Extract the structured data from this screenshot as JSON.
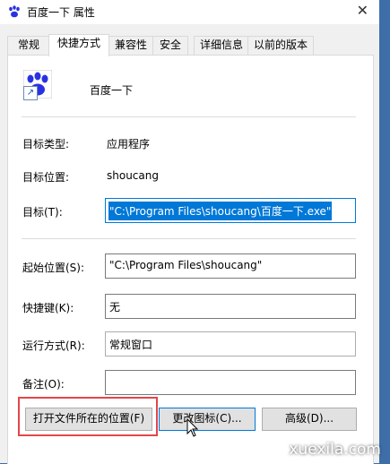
{
  "window": {
    "title": "百度一下 属性"
  },
  "tabs": [
    {
      "label": "常规"
    },
    {
      "label": "快捷方式"
    },
    {
      "label": "兼容性"
    },
    {
      "label": "安全"
    },
    {
      "label": "详细信息"
    },
    {
      "label": "以前的版本"
    }
  ],
  "active_tab": "快捷方式",
  "shortcut": {
    "name": "百度一下",
    "target_type_label": "目标类型:",
    "target_type_value": "应用程序",
    "target_location_label": "目标位置:",
    "target_location_value": "shoucang",
    "target_label": "目标(T):",
    "target_value": "\"C:\\Program Files\\shoucang\\百度一下.exe\"",
    "start_in_label": "起始位置(S):",
    "start_in_value": "\"C:\\Program Files\\shoucang\"",
    "hotkey_label": "快捷键(K):",
    "hotkey_value": "无",
    "run_label": "运行方式(R):",
    "run_value": "常规窗口",
    "comment_label": "备注(O):",
    "comment_value": ""
  },
  "buttons": {
    "open_location": "打开文件所在的位置(F)",
    "change_icon": "更改图标(C)...",
    "advanced": "高级(D)..."
  },
  "watermark": "xuexila.com",
  "colors": {
    "accent": "#0078d7",
    "highlight_box": "#e2474b",
    "paw": "#2932e1"
  }
}
